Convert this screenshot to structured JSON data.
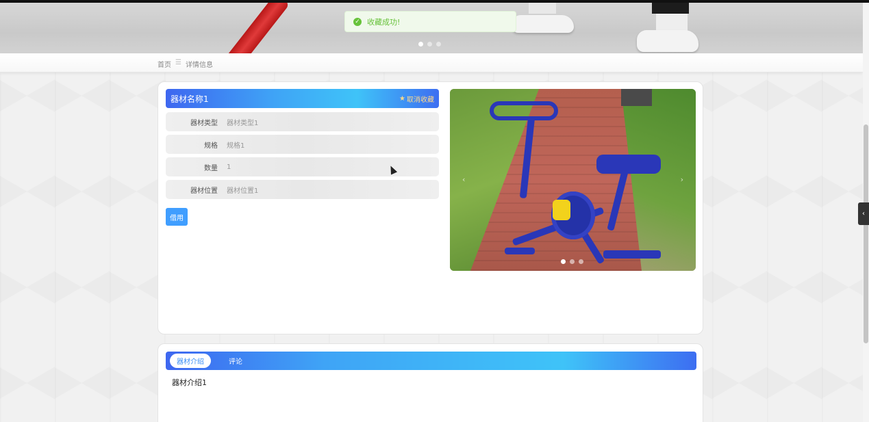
{
  "toast": {
    "message": "收藏成功!"
  },
  "breadcrumb": {
    "home": "首页",
    "separator": "☰",
    "current": "详情信息"
  },
  "detail": {
    "name": "器材名称1",
    "favorite_label": "取消收藏",
    "fields": [
      {
        "key": "器材类型",
        "value": "器材类型1"
      },
      {
        "key": "规格",
        "value": "规格1"
      },
      {
        "key": "数量",
        "value": "1"
      },
      {
        "key": "器材位置",
        "value": "器材位置1"
      }
    ],
    "borrow_label": "借用"
  },
  "carousel": {
    "prev": "‹",
    "next": "›",
    "slides": 3,
    "active_index": 0
  },
  "banner": {
    "slides": 3,
    "active_index": 0
  },
  "tabs": [
    {
      "label": "器材介绍",
      "active": true
    },
    {
      "label": "评论",
      "active": false
    }
  ],
  "intro_text": "器材介绍1",
  "colors": {
    "accent_blue": "#409eff",
    "gradient_start": "#3e67f0",
    "gradient_mid": "#3fc3f8",
    "success": "#67c23a",
    "favorite": "#ffd98a"
  }
}
